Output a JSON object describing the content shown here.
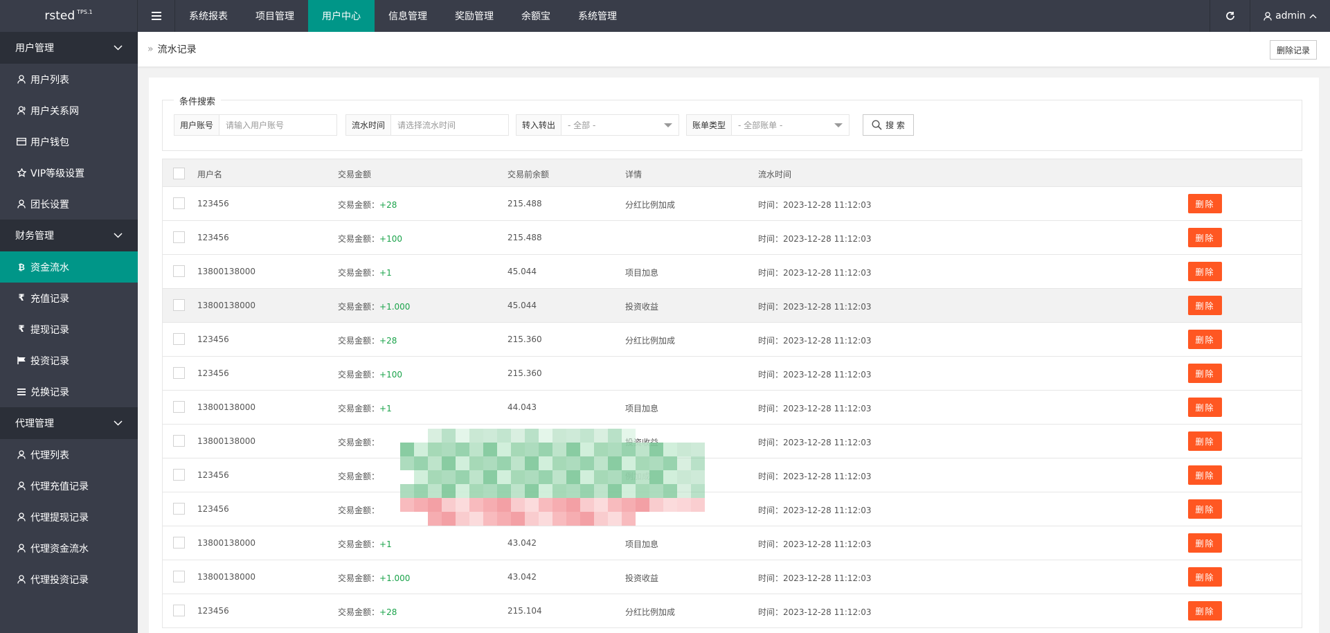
{
  "app": {
    "logo": "rsted",
    "logo_sup": "TPS.1"
  },
  "topnav": {
    "items": [
      "系统报表",
      "项目管理",
      "用户中心",
      "信息管理",
      "奖励管理",
      "余额宝",
      "系统管理"
    ],
    "active": "用户中心"
  },
  "user": {
    "name": "admin"
  },
  "sidebar": {
    "groups": [
      {
        "label": "用户管理",
        "items": [
          {
            "label": "用户列表",
            "icon": "user-icon"
          },
          {
            "label": "用户关系网",
            "icon": "users-icon"
          },
          {
            "label": "用户钱包",
            "icon": "wallet-icon"
          },
          {
            "label": "VIP等级设置",
            "icon": "star-icon"
          },
          {
            "label": "团长设置",
            "icon": "user-icon"
          }
        ]
      },
      {
        "label": "财务管理",
        "items": [
          {
            "label": "资金流水",
            "icon": "bitcoin-icon",
            "active": true
          },
          {
            "label": "充值记录",
            "icon": "rupee-icon"
          },
          {
            "label": "提现记录",
            "icon": "rupee-icon"
          },
          {
            "label": "投资记录",
            "icon": "flag-icon"
          },
          {
            "label": "兑换记录",
            "icon": "list-icon"
          }
        ]
      },
      {
        "label": "代理管理",
        "items": [
          {
            "label": "代理列表",
            "icon": "user-icon"
          },
          {
            "label": "代理充值记录",
            "icon": "user-icon"
          },
          {
            "label": "代理提现记录",
            "icon": "user-icon"
          },
          {
            "label": "代理资金流水",
            "icon": "user-icon"
          },
          {
            "label": "代理投资记录",
            "icon": "user-icon"
          }
        ]
      }
    ]
  },
  "breadcrumb": {
    "sep": "»",
    "current": "流水记录"
  },
  "actions": {
    "delete_records": "删除记录"
  },
  "search": {
    "legend": "条件搜索",
    "account_label": "用户账号",
    "account_placeholder": "请输入用户账号",
    "time_label": "流水时间",
    "time_placeholder": "请选择流水时间",
    "direction_label": "转入转出",
    "direction_value": "- 全部 -",
    "type_label": "账单类型",
    "type_value": "- 全部账单 -",
    "button": "搜 索"
  },
  "table": {
    "headers": [
      "用户名",
      "交易金额",
      "交易前余额",
      "详情",
      "流水时间"
    ],
    "amount_prefix": "交易金额：",
    "time_prefix": "时间：",
    "delete_label": "删除",
    "rows": [
      {
        "user": "123456",
        "amount": "+28",
        "balance": "215.488",
        "detail": "分红比例加成",
        "time": "2023-12-28 11:12:03"
      },
      {
        "user": "123456",
        "amount": "+100",
        "balance": "215.488",
        "detail": "",
        "time": "2023-12-28 11:12:03"
      },
      {
        "user": "13800138000",
        "amount": "+1",
        "balance": "45.044",
        "detail": "项目加息",
        "time": "2023-12-28 11:12:03"
      },
      {
        "user": "13800138000",
        "amount": "+1.000",
        "balance": "45.044",
        "detail": "投资收益",
        "time": "2023-12-28 11:12:03"
      },
      {
        "user": "123456",
        "amount": "+28",
        "balance": "215.360",
        "detail": "分红比例加成",
        "time": "2023-12-28 11:12:03"
      },
      {
        "user": "123456",
        "amount": "+100",
        "balance": "215.360",
        "detail": "",
        "time": "2023-12-28 11:12:03"
      },
      {
        "user": "13800138000",
        "amount": "+1",
        "balance": "44.043",
        "detail": "项目加息",
        "time": "2023-12-28 11:12:03"
      },
      {
        "user": "13800138000",
        "amount": "",
        "balance": "",
        "detail": "投资收益",
        "time": "2023-12-28 11:12:03"
      },
      {
        "user": "123456",
        "amount": "",
        "balance": "",
        "detail": "例加成",
        "time": "2023-12-28 11:12:03"
      },
      {
        "user": "123456",
        "amount": "",
        "balance": "",
        "detail": "",
        "time": "2023-12-28 11:12:03"
      },
      {
        "user": "13800138000",
        "amount": "+1",
        "balance": "43.042",
        "detail": "项目加息",
        "time": "2023-12-28 11:12:03"
      },
      {
        "user": "13800138000",
        "amount": "+1.000",
        "balance": "43.042",
        "detail": "投资收益",
        "time": "2023-12-28 11:12:03"
      },
      {
        "user": "123456",
        "amount": "+28",
        "balance": "215.104",
        "detail": "分红比例加成",
        "time": "2023-12-28 11:12:03"
      }
    ]
  },
  "colors": {
    "primary": "#009688",
    "danger": "#ff5722",
    "sidebar": "#393d49",
    "positive": "#1aa34a"
  }
}
